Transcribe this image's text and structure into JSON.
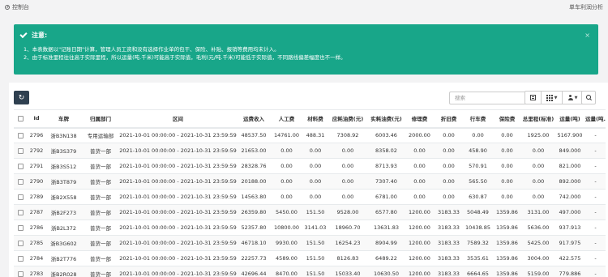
{
  "header": {
    "crumb": "控制台",
    "right_title": "单车利润分析"
  },
  "alert": {
    "title": "注意:",
    "line1": "1、本表数据以\"记账日期\"计算，管理人员工资和没有选择作业单的包干、保险、补贴、报销等费用均未计入。",
    "line2": "2、由于标准里程往往高于实际里程，所以运量(吨.千米)可能高于实际值，毛利(元/吨.千米)可能低于实际值，不同路线偏差幅度也不一样。",
    "close": "×"
  },
  "toolbar": {
    "search_placeholder": "搜索"
  },
  "table": {
    "columns": [
      "Id",
      "车牌",
      "归属部门",
      "区间",
      "运费收入",
      "人工费",
      "材料费",
      "应耗油费(元)",
      "实耗油费(元)",
      "修理费",
      "折旧费",
      "行车费",
      "保险费",
      "总里程(标准)",
      "运量(吨)",
      "运量(吨.千米)"
    ],
    "rows": [
      [
        "2796",
        "浙B3N138",
        "专用运输部",
        "2021-10-01 00:00:00 - 2021-10-31 23:59:59",
        "48537.50",
        "14761.00",
        "488.31",
        "7308.92",
        "6003.46",
        "2000.00",
        "0.00",
        "0.00",
        "0.00",
        "1925.00",
        "5167.900",
        "-"
      ],
      [
        "2792",
        "浙B3S379",
        "普货一部",
        "2021-10-01 00:00:00 - 2021-10-31 23:59:59",
        "21653.00",
        "0.00",
        "0.00",
        "0.00",
        "8358.02",
        "0.00",
        "0.00",
        "458.90",
        "0.00",
        "0.00",
        "849.000",
        "-"
      ],
      [
        "2791",
        "浙B3S512",
        "普货一部",
        "2021-10-01 00:00:00 - 2021-10-31 23:59:59",
        "28328.76",
        "0.00",
        "0.00",
        "0.00",
        "8713.93",
        "0.00",
        "0.00",
        "570.91",
        "0.00",
        "0.00",
        "821.000",
        "-"
      ],
      [
        "2790",
        "浙B3T879",
        "普货一部",
        "2021-10-01 00:00:00 - 2021-10-31 23:59:59",
        "20188.00",
        "0.00",
        "0.00",
        "0.00",
        "7307.40",
        "0.00",
        "0.00",
        "565.50",
        "0.00",
        "0.00",
        "892.000",
        "-"
      ],
      [
        "2789",
        "浙B2X558",
        "普货一部",
        "2021-10-01 00:00:00 - 2021-10-31 23:59:59",
        "14563.80",
        "0.00",
        "0.00",
        "0.00",
        "6781.00",
        "0.00",
        "0.00",
        "630.87",
        "0.00",
        "0.00",
        "742.000",
        "-"
      ],
      [
        "2787",
        "浙B2F273",
        "普货一部",
        "2021-10-01 00:00:00 - 2021-10-31 23:59:59",
        "26359.80",
        "5450.00",
        "151.50",
        "9528.00",
        "6577.80",
        "1200.00",
        "3183.33",
        "5048.49",
        "1359.86",
        "3131.00",
        "497.000",
        "-"
      ],
      [
        "2786",
        "浙B2L372",
        "普货一部",
        "2021-10-01 00:00:00 - 2021-10-31 23:59:59",
        "52357.80",
        "10800.00",
        "3141.03",
        "18960.70",
        "13631.83",
        "1200.00",
        "3183.33",
        "10438.85",
        "1359.86",
        "5636.00",
        "937.913",
        "-"
      ],
      [
        "2785",
        "浙B3G602",
        "普货一部",
        "2021-10-01 00:00:00 - 2021-10-31 23:59:59",
        "46718.10",
        "9930.00",
        "151.50",
        "16254.23",
        "8904.99",
        "1200.00",
        "3183.33",
        "7589.32",
        "1359.86",
        "5425.00",
        "917.975",
        "-"
      ],
      [
        "2784",
        "浙B2T776",
        "普货一部",
        "2021-10-01 00:00:00 - 2021-10-31 23:59:59",
        "22257.73",
        "4589.00",
        "151.50",
        "8126.83",
        "6489.22",
        "1200.00",
        "3183.33",
        "3535.61",
        "1359.86",
        "3004.00",
        "422.575",
        "-"
      ],
      [
        "2783",
        "浙B2R028",
        "普货一部",
        "2021-10-01 00:00:00 - 2021-10-31 23:59:59",
        "42696.44",
        "8470.00",
        "151.50",
        "15033.40",
        "10630.50",
        "1200.00",
        "3183.33",
        "6664.65",
        "1359.86",
        "5159.00",
        "779.886",
        "-"
      ]
    ]
  }
}
